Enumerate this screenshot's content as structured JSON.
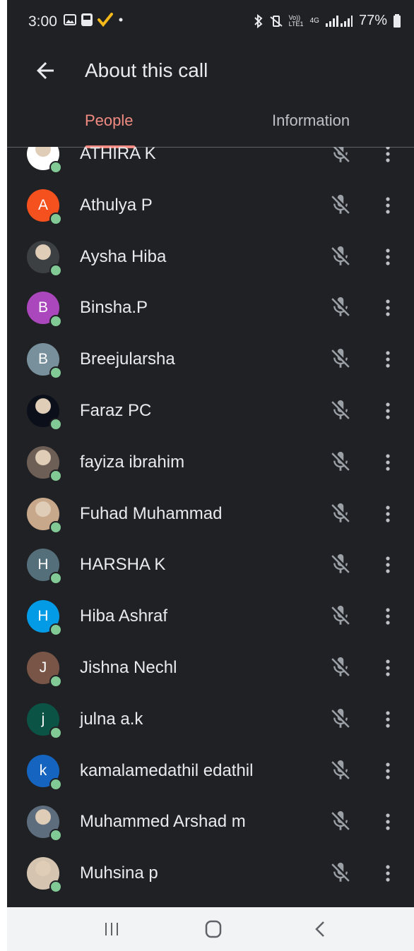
{
  "status_bar": {
    "time": "3:00",
    "battery": "77%",
    "network_volte": "Vo)) LTE1",
    "network_4g": "4G"
  },
  "header": {
    "title": "About this call"
  },
  "tabs": [
    {
      "label": "People",
      "selected": true
    },
    {
      "label": "Information",
      "selected": false
    }
  ],
  "participants": [
    {
      "name": "ATHIRA K",
      "initial": "",
      "avatar_color": "#ffffff",
      "avatar": "photo",
      "muted": true
    },
    {
      "name": "Athulya P",
      "initial": "A",
      "avatar_color": "#f4511e",
      "avatar": "letter",
      "muted": true
    },
    {
      "name": "Aysha Hiba",
      "initial": "",
      "avatar_color": "#3c4043",
      "avatar": "photo",
      "muted": true
    },
    {
      "name": "Binsha.P",
      "initial": "B",
      "avatar_color": "#ab47bc",
      "avatar": "letter",
      "muted": true
    },
    {
      "name": "Breejularsha",
      "initial": "B",
      "avatar_color": "#78909c",
      "avatar": "letter",
      "muted": true
    },
    {
      "name": "Faraz PC",
      "initial": "",
      "avatar_color": "#0b0f1a",
      "avatar": "photo",
      "muted": true
    },
    {
      "name": "fayiza ibrahim",
      "initial": "",
      "avatar_color": "#6d5f55",
      "avatar": "photo",
      "muted": true
    },
    {
      "name": "Fuhad Muhammad",
      "initial": "",
      "avatar_color": "#c8a88a",
      "avatar": "photo",
      "muted": true
    },
    {
      "name": "HARSHA K",
      "initial": "H",
      "avatar_color": "#546e7a",
      "avatar": "letter",
      "muted": true
    },
    {
      "name": "Hiba Ashraf",
      "initial": "H",
      "avatar_color": "#039be5",
      "avatar": "letter",
      "muted": true
    },
    {
      "name": "Jishna Nechl",
      "initial": "J",
      "avatar_color": "#795548",
      "avatar": "letter",
      "muted": true
    },
    {
      "name": "julna a.k",
      "initial": "j",
      "avatar_color": "#0b5345",
      "avatar": "letter",
      "muted": true
    },
    {
      "name": "kamalamedathil edathil",
      "initial": "k",
      "avatar_color": "#1565c0",
      "avatar": "letter",
      "muted": true
    },
    {
      "name": "Muhammed Arshad m",
      "initial": "",
      "avatar_color": "#5d6d7e",
      "avatar": "photo",
      "muted": true
    },
    {
      "name": "Muhsina p",
      "initial": "",
      "avatar_color": "#d5c4b0",
      "avatar": "photo",
      "muted": true
    }
  ],
  "icons": {
    "back": "arrow-back-icon",
    "mic_off": "mic-off-icon",
    "more": "more-vert-icon",
    "nav_recents": "recents-icon",
    "nav_home": "home-icon",
    "nav_back": "nav-back-icon"
  }
}
